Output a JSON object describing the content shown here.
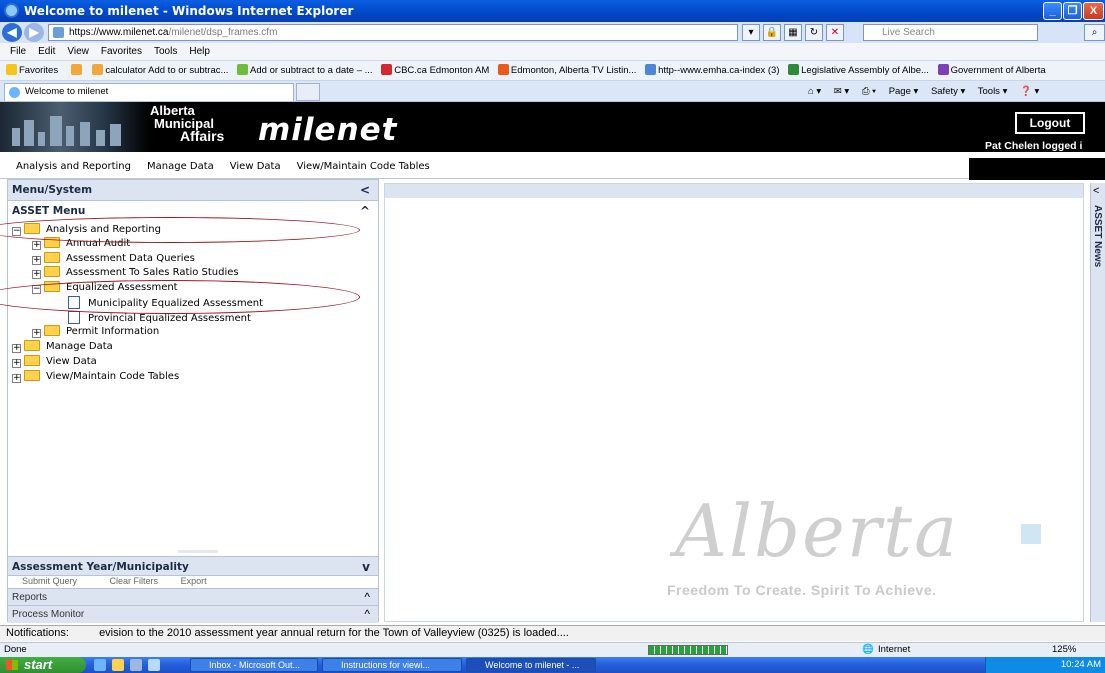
{
  "window": {
    "title": "Welcome to milenet - Windows Internet Explorer",
    "controls": [
      "_",
      "❐",
      "X"
    ]
  },
  "address": {
    "url_host": "https://www.milenet.ca",
    "url_path": "/milenet/dsp_frames.cfm",
    "search_placeholder": "Live Search"
  },
  "menubar": [
    "File",
    "Edit",
    "View",
    "Favorites",
    "Tools",
    "Help"
  ],
  "favorites": {
    "label": "Favorites",
    "items": [
      "calculator Add to or subtrac...",
      "Add or subtract to a date – ...",
      "CBC.ca Edmonton AM",
      "Edmonton, Alberta TV Listin...",
      "http--www.emha.ca-index (3)",
      "Legislative Assembly of Albe...",
      "Government of Alberta"
    ],
    "colors": [
      "#f2a73b",
      "#6bbf3a",
      "#d8262e",
      "#e95b1c",
      "#4d86d6",
      "#2e8b3a",
      "#7b3fb6"
    ]
  },
  "tab": {
    "label": "Welcome to milenet"
  },
  "commandbar": [
    "⌂ ▾",
    "✉ ▾",
    "⎙ ▾",
    "Page ▾",
    "Safety ▾",
    "Tools ▾",
    "❓ ▾"
  ],
  "header": {
    "org_line1": "Alberta",
    "org_line2": "Municipal",
    "org_line3": "Affairs",
    "app_name": "milenet",
    "logout_label": "Logout",
    "logged_in": "Pat Chelen logged i"
  },
  "mainnav": [
    "Analysis and Reporting",
    "Manage Data",
    "View Data",
    "View/Maintain Code Tables"
  ],
  "leftpanel": {
    "menu_system": "Menu/System",
    "asset_menu": "ASSET Menu",
    "tree": [
      {
        "label": "Analysis and Reporting",
        "level": 0,
        "expander": "−",
        "type": "folder-open"
      },
      {
        "label": "Annual Audit",
        "level": 1,
        "expander": "+",
        "type": "folder"
      },
      {
        "label": "Assessment Data Queries",
        "level": 1,
        "expander": "+",
        "type": "folder"
      },
      {
        "label": "Assessment To Sales Ratio Studies",
        "level": 1,
        "expander": "+",
        "type": "folder"
      },
      {
        "label": "Equalized Assessment",
        "level": 1,
        "expander": "−",
        "type": "folder-open"
      },
      {
        "label": "Municipality Equalized Assessment",
        "level": 2,
        "expander": "",
        "type": "doc"
      },
      {
        "label": "Provincial Equalized Assessment",
        "level": 2,
        "expander": "",
        "type": "doc"
      },
      {
        "label": "Permit Information",
        "level": 1,
        "expander": "+",
        "type": "folder"
      },
      {
        "label": "Manage Data",
        "level": 0,
        "expander": "+",
        "type": "folder"
      },
      {
        "label": "View Data",
        "level": 0,
        "expander": "+",
        "type": "folder"
      },
      {
        "label": "View/Maintain Code Tables",
        "level": 0,
        "expander": "+",
        "type": "folder"
      }
    ],
    "assessment_year": "Assessment Year/Municipality",
    "tools": [
      "Submit Query",
      "Clear Filters",
      "Export"
    ],
    "reports": "Reports",
    "process_monitor": "Process Monitor"
  },
  "content": {
    "watermark": "Alberta",
    "slogan": "Freedom To Create. Spirit To Achieve."
  },
  "newsbar": {
    "label": "ASSET News"
  },
  "notifications": {
    "label": "Notifications:",
    "text": "evision to the 2010 assessment year annual return for the Town of Valleyview (0325) is loaded...."
  },
  "ie_status": {
    "left": "Done",
    "zone": "Internet",
    "zoom": "125%"
  },
  "taskbar": {
    "start": "start",
    "buttons": [
      "Inbox - Microsoft Out...",
      "Instructions for viewi...",
      "Welcome to milenet - ..."
    ],
    "clock": "10:24 AM"
  }
}
